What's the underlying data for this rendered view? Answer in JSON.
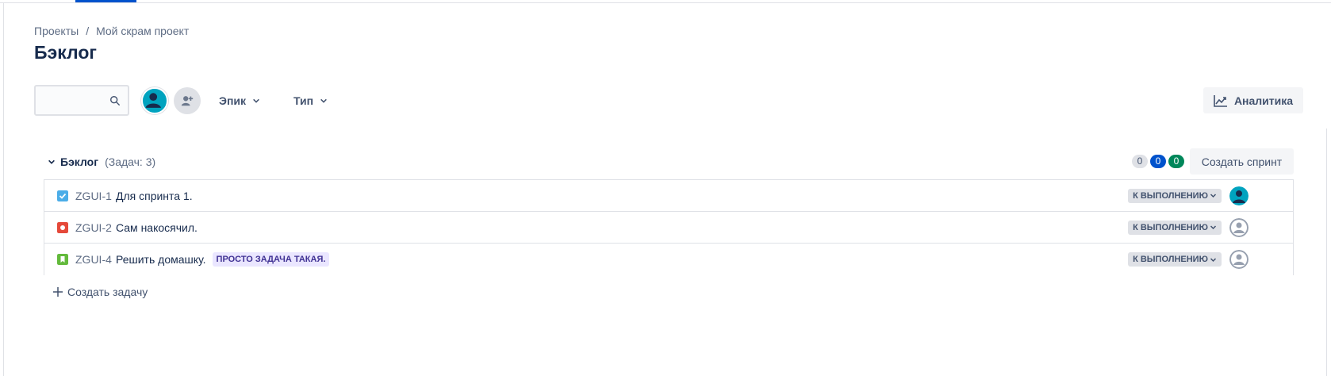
{
  "breadcrumb": {
    "projects": "Проекты",
    "separator": "/",
    "project": "Мой скрам проект"
  },
  "page": {
    "title": "Бэклог"
  },
  "search": {
    "placeholder": "",
    "icon": "search-icon"
  },
  "filters": {
    "epic": "Эпик",
    "type": "Тип"
  },
  "analytics": {
    "label": "Аналитика",
    "icon": "chart-line-icon"
  },
  "backlog": {
    "title": "Бэклог",
    "count": "(Задач: 3)",
    "badges": [
      {
        "value": "0",
        "color": "#dfe1e6"
      },
      {
        "value": "0",
        "color": "#0052cc"
      },
      {
        "value": "0",
        "color": "#00875a"
      }
    ],
    "create_sprint": "Создать спринт",
    "issues": [
      {
        "type": "task",
        "type_color": "#4bade8",
        "key": "ZGUI-1",
        "summary": "Для спринта 1.",
        "epic": "",
        "status": "К выполнению",
        "assignee": "user"
      },
      {
        "type": "bug",
        "type_color": "#e5493a",
        "key": "ZGUI-2",
        "summary": "Сам накосячил.",
        "epic": "",
        "status": "К выполнению",
        "assignee": "unassigned"
      },
      {
        "type": "story",
        "type_color": "#63ba3c",
        "key": "ZGUI-4",
        "summary": "Решить домашку.",
        "epic": "Просто задача такая.",
        "status": "К выполнению",
        "assignee": "unassigned"
      }
    ],
    "create_task": "Создать задачу"
  }
}
